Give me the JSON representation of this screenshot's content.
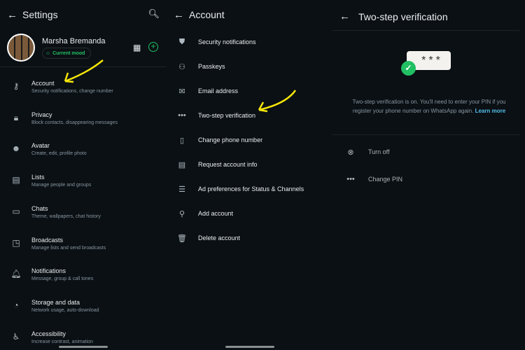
{
  "settings": {
    "title": "Settings",
    "profile": {
      "name": "Marsha Bremanda",
      "mood": "Current mood"
    },
    "items": [
      {
        "label": "Account",
        "sub": "Security notifications, change number",
        "icon": "key-icon"
      },
      {
        "label": "Privacy",
        "sub": "Block contacts, disappearing messages",
        "icon": "lock-icon"
      },
      {
        "label": "Avatar",
        "sub": "Create, edit, profile photo",
        "icon": "avatar-icon"
      },
      {
        "label": "Lists",
        "sub": "Manage people and groups",
        "icon": "lists-icon"
      },
      {
        "label": "Chats",
        "sub": "Theme, wallpapers, chat history",
        "icon": "chat-icon"
      },
      {
        "label": "Broadcasts",
        "sub": "Manage lists and send broadcasts",
        "icon": "broadcast-icon"
      },
      {
        "label": "Notifications",
        "sub": "Message, group & call tones",
        "icon": "bell-icon"
      },
      {
        "label": "Storage and data",
        "sub": "Network usage, auto-download",
        "icon": "storage-icon"
      },
      {
        "label": "Accessibility",
        "sub": "Increase contrast, animation",
        "icon": "accessibility-icon"
      }
    ]
  },
  "account": {
    "title": "Account",
    "items": [
      {
        "label": "Security notifications",
        "icon": "shield-icon"
      },
      {
        "label": "Passkeys",
        "icon": "passkey-icon"
      },
      {
        "label": "Email address",
        "icon": "mail-icon"
      },
      {
        "label": "Two-step verification",
        "icon": "dots-icon"
      },
      {
        "label": "Change phone number",
        "icon": "phone-change-icon"
      },
      {
        "label": "Request account info",
        "icon": "document-icon"
      },
      {
        "label": "Ad preferences for Status & Channels",
        "icon": "sliders-icon"
      },
      {
        "label": "Add account",
        "icon": "add-person-icon"
      },
      {
        "label": "Delete account",
        "icon": "trash-icon"
      }
    ]
  },
  "twostep": {
    "title": "Two-step verification",
    "pin_mask": "***",
    "info": "Two-step verification is on. You'll need to enter your PIN if you register your phone number on WhatsApp again.",
    "learn_more": "Learn more",
    "actions": [
      {
        "label": "Turn off",
        "icon": "close-circle-icon"
      },
      {
        "label": "Change PIN",
        "icon": "dots-icon"
      }
    ]
  },
  "colors": {
    "accent": "#21c063",
    "link": "#53bdeb",
    "background": "#0b1014",
    "annotation": "#f5e50a"
  }
}
